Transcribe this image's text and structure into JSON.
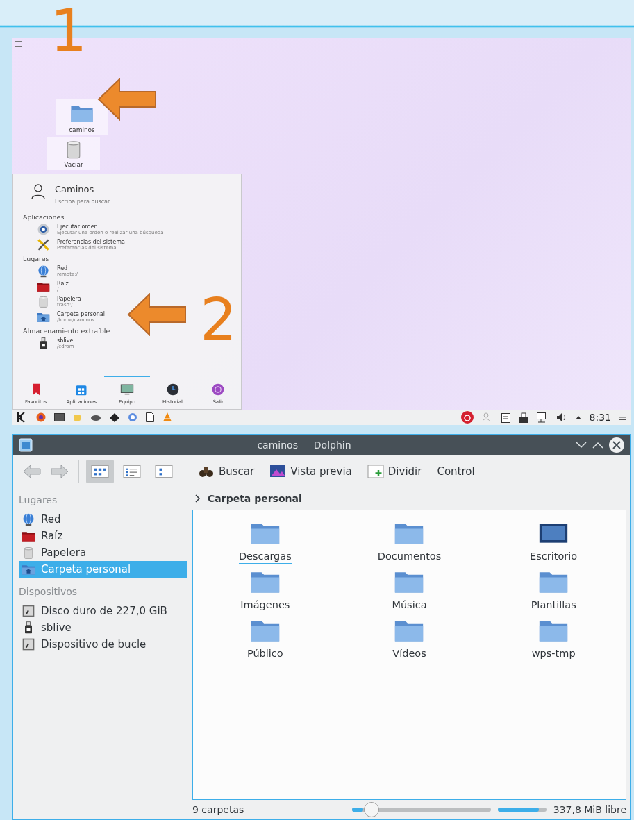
{
  "annotations": [
    {
      "label": "1"
    },
    {
      "label": "2"
    }
  ],
  "desktop": {
    "icons": [
      {
        "label": "caminos",
        "kind": "folder"
      },
      {
        "label": "Vaciar",
        "kind": "trash"
      }
    ],
    "launcher": {
      "user": "Caminos",
      "placeholder": "Escriba para buscar...",
      "sections": [
        {
          "title": "Aplicaciones",
          "items": [
            {
              "name": "Ejecutar orden...",
              "detail": "Ejecutar una orden o realizar una búsqueda",
              "kind": "gear"
            },
            {
              "name": "Preferencias del sistema",
              "detail": "Preferencias del sistema",
              "kind": "tools"
            }
          ]
        },
        {
          "title": "Lugares",
          "items": [
            {
              "name": "Red",
              "detail": "remote:/",
              "kind": "globe"
            },
            {
              "name": "Raíz",
              "detail": "/",
              "kind": "redfolder"
            },
            {
              "name": "Papelera",
              "detail": "trash:/",
              "kind": "trash"
            },
            {
              "name": "Carpeta personal",
              "detail": "/home/caminos",
              "kind": "home"
            }
          ]
        },
        {
          "title": "Almacenamiento extraíble",
          "items": [
            {
              "name": "sblive",
              "detail": "/cdrom",
              "kind": "usb"
            }
          ]
        }
      ],
      "tabs": [
        {
          "label": "Favoritos",
          "kind": "bookmark",
          "selected": false
        },
        {
          "label": "Aplicaciones",
          "kind": "apps",
          "selected": false
        },
        {
          "label": "Equipo",
          "kind": "monitor",
          "selected": true
        },
        {
          "label": "Historial",
          "kind": "clock",
          "selected": false
        },
        {
          "label": "Salir",
          "kind": "exit",
          "selected": false
        }
      ]
    },
    "taskbar": {
      "clock": "8:31"
    }
  },
  "dolphin": {
    "title": "caminos — Dolphin",
    "views": [
      {
        "kind": "icons",
        "selected": true
      },
      {
        "kind": "compact",
        "selected": false
      },
      {
        "kind": "details",
        "selected": false
      }
    ],
    "actions": [
      {
        "label": "Buscar",
        "kind": "binoculars"
      },
      {
        "label": "Vista previa",
        "kind": "preview"
      },
      {
        "label": "Dividir",
        "kind": "split"
      },
      {
        "label": "Control",
        "kind": "none"
      }
    ],
    "sidebar": [
      {
        "title": "Lugares",
        "items": [
          {
            "label": "Red",
            "kind": "globe",
            "selected": false
          },
          {
            "label": "Raíz",
            "kind": "redfolder",
            "selected": false
          },
          {
            "label": "Papelera",
            "kind": "trash",
            "selected": false
          },
          {
            "label": "Carpeta personal",
            "kind": "home",
            "selected": true
          }
        ]
      },
      {
        "title": "Dispositivos",
        "items": [
          {
            "label": "Disco duro de 227,0 GiB",
            "kind": "disk",
            "selected": false
          },
          {
            "label": "sblive",
            "kind": "usb",
            "selected": false
          },
          {
            "label": "Dispositivo de bucle",
            "kind": "disk",
            "selected": false
          }
        ]
      }
    ],
    "breadcrumb": "Carpeta personal",
    "files": [
      {
        "name": "Descargas",
        "kind": "folder",
        "focused": true
      },
      {
        "name": "Documentos",
        "kind": "folder",
        "focused": false
      },
      {
        "name": "Escritorio",
        "kind": "desktop",
        "focused": false
      },
      {
        "name": "Imágenes",
        "kind": "folder",
        "focused": false
      },
      {
        "name": "Música",
        "kind": "folder",
        "focused": false
      },
      {
        "name": "Plantillas",
        "kind": "folder",
        "focused": false
      },
      {
        "name": "Público",
        "kind": "folder",
        "focused": false
      },
      {
        "name": "Vídeos",
        "kind": "folder",
        "focused": false
      },
      {
        "name": "wps-tmp",
        "kind": "folder",
        "focused": false
      }
    ],
    "status": "9 carpetas",
    "zoom": {
      "level": 0.08
    },
    "free_space": {
      "level": 0.85,
      "reading": "337,8 MiB libre"
    }
  }
}
